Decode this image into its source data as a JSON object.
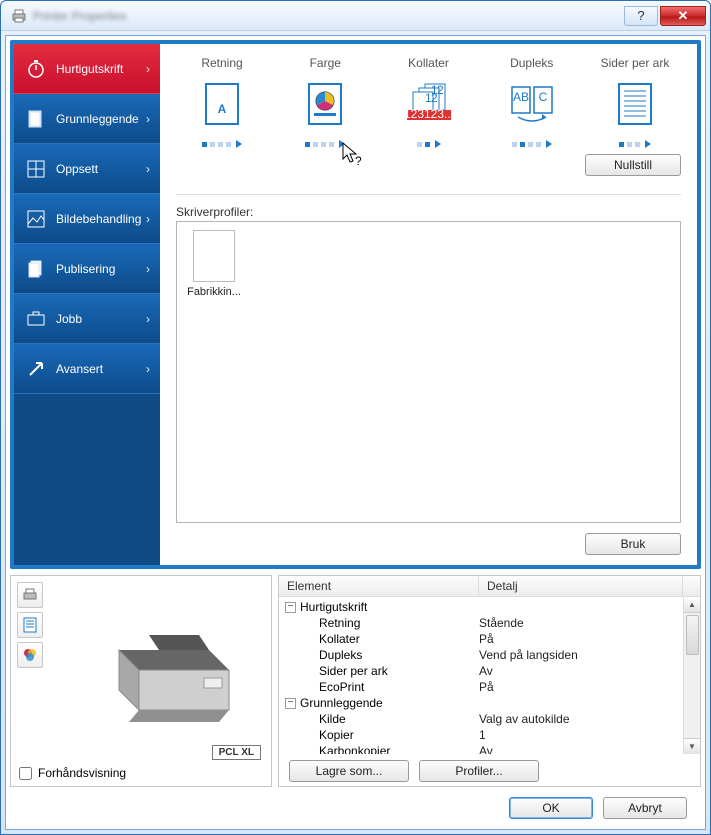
{
  "window": {
    "title": "Printer Properties"
  },
  "sidebar": {
    "items": [
      {
        "label": "Hurtigutskrift"
      },
      {
        "label": "Grunnleggende"
      },
      {
        "label": "Oppsett"
      },
      {
        "label": "Bildebehandling"
      },
      {
        "label": "Publisering"
      },
      {
        "label": "Jobb"
      },
      {
        "label": "Avansert"
      }
    ]
  },
  "options": [
    {
      "label": "Retning"
    },
    {
      "label": "Farge"
    },
    {
      "label": "Kollater"
    },
    {
      "label": "Dupleks"
    },
    {
      "label": "Sider per ark"
    }
  ],
  "buttons": {
    "reset": "Nullstill",
    "apply": "Bruk",
    "save_as": "Lagre som...",
    "profiles": "Profiler...",
    "ok": "OK",
    "cancel": "Avbryt"
  },
  "profiles": {
    "label": "Skriverprofiler:",
    "items": [
      {
        "name": "Fabrikkin..."
      }
    ]
  },
  "preview": {
    "pdl": "PCL XL",
    "checkbox_label": "Forhåndsvisning"
  },
  "settings": {
    "columns": {
      "element": "Element",
      "detail": "Detalj"
    },
    "groups": [
      {
        "name": "Hurtigutskrift",
        "rows": [
          {
            "el": "Retning",
            "dt": "Stående"
          },
          {
            "el": "Kollater",
            "dt": "På"
          },
          {
            "el": "Dupleks",
            "dt": "Vend på langsiden"
          },
          {
            "el": "Sider per ark",
            "dt": "Av"
          },
          {
            "el": "EcoPrint",
            "dt": "På"
          }
        ]
      },
      {
        "name": "Grunnleggende",
        "rows": [
          {
            "el": "Kilde",
            "dt": "Valg av autokilde"
          },
          {
            "el": "Kopier",
            "dt": "1"
          },
          {
            "el": "Karbonkopier",
            "dt": "Av"
          }
        ]
      }
    ]
  }
}
